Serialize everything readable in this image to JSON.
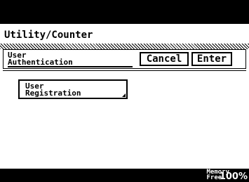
{
  "header": {
    "title": "Utility/Counter"
  },
  "tab": {
    "label_line1": "User",
    "label_line2": "Authentication"
  },
  "buttons": {
    "cancel_label": "Cancel",
    "enter_label": "Enter"
  },
  "content": {
    "registration_line1": "User",
    "registration_line2": "Registration"
  },
  "status": {
    "memory_line1": "Memory",
    "memory_line2": "Free",
    "memory_percent": "100%"
  }
}
